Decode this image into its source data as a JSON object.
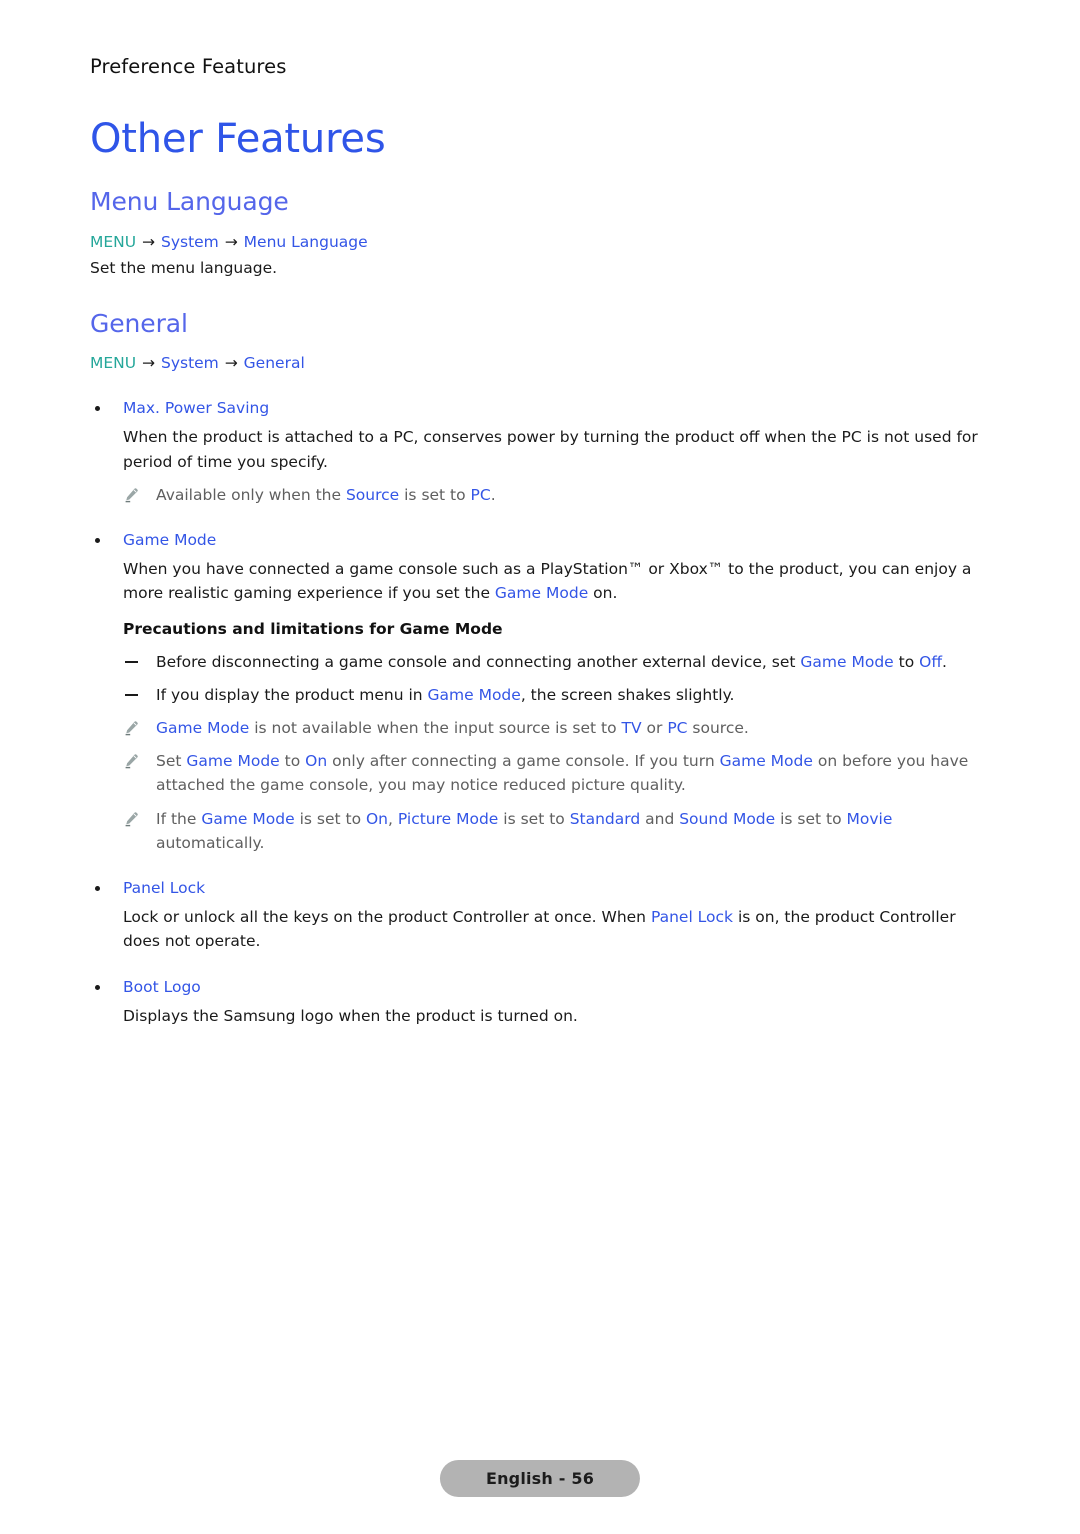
{
  "running_head": "Preference Features",
  "chapter_title": "Other Features",
  "colors": {
    "chapter_blue": "#2f55e8",
    "section_blue": "#5566ea",
    "keyword_blue": "#3355e6",
    "menu_teal": "#25a79a",
    "note_gray": "#5f5f5f",
    "footer_gray": "#b3b3b3"
  },
  "sections": [
    {
      "title": "Menu Language",
      "menu_path": {
        "menu": "MENU",
        "arrow": "→",
        "items": [
          "System",
          "Menu Language"
        ]
      },
      "description": "Set the menu language."
    },
    {
      "title": "General",
      "menu_path": {
        "menu": "MENU",
        "arrow": "→",
        "items": [
          "System",
          "General"
        ]
      }
    }
  ],
  "bullets": [
    {
      "label": "Max. Power Saving",
      "body_part_1": "When the product is attached to a PC, conserves power by turning the product off when the PC is not used for period of time you specify.",
      "notes": [
        {
          "icon": "pencil-icon",
          "runs": [
            {
              "t": "Available only when the ",
              "style": "plain"
            },
            {
              "t": "Source",
              "style": "kw"
            },
            {
              "t": " is set to ",
              "style": "plain"
            },
            {
              "t": "PC",
              "style": "kw"
            },
            {
              "t": ".",
              "style": "plain"
            }
          ]
        }
      ]
    },
    {
      "label": "Game Mode",
      "body_runs": [
        {
          "t": "When you have connected a game console such as a PlayStation™ or Xbox™ to the product, you can enjoy a more realistic gaming experience if you set the ",
          "style": "plain"
        },
        {
          "t": "Game Mode",
          "style": "kw"
        },
        {
          "t": " on.",
          "style": "plain"
        }
      ],
      "sub_head": "Precautions and limitations for Game Mode",
      "dashes": [
        {
          "runs": [
            {
              "t": "Before disconnecting a game console and connecting another external device, set ",
              "style": "plain"
            },
            {
              "t": "Game Mode",
              "style": "kw"
            },
            {
              "t": " to ",
              "style": "plain"
            },
            {
              "t": "Off",
              "style": "kw"
            },
            {
              "t": ".",
              "style": "plain"
            }
          ]
        },
        {
          "runs": [
            {
              "t": "If you display the product menu in ",
              "style": "plain"
            },
            {
              "t": "Game Mode",
              "style": "kw"
            },
            {
              "t": ", the screen shakes slightly.",
              "style": "plain"
            }
          ]
        }
      ],
      "notes": [
        {
          "icon": "pencil-icon",
          "runs": [
            {
              "t": "Game Mode",
              "style": "kw"
            },
            {
              "t": " is not available when the input source is set to ",
              "style": "plain"
            },
            {
              "t": "TV",
              "style": "kw"
            },
            {
              "t": " or ",
              "style": "plain"
            },
            {
              "t": "PC",
              "style": "kw"
            },
            {
              "t": " source.",
              "style": "plain"
            }
          ]
        },
        {
          "icon": "pencil-icon",
          "runs": [
            {
              "t": "Set ",
              "style": "plain"
            },
            {
              "t": "Game Mode",
              "style": "kw"
            },
            {
              "t": " to ",
              "style": "plain"
            },
            {
              "t": "On",
              "style": "kw"
            },
            {
              "t": " only after connecting a game console. If you turn ",
              "style": "plain"
            },
            {
              "t": "Game Mode",
              "style": "kw"
            },
            {
              "t": " on before you have attached the game console, you may notice reduced picture quality.",
              "style": "plain"
            }
          ]
        },
        {
          "icon": "pencil-icon",
          "runs": [
            {
              "t": "If the ",
              "style": "plain"
            },
            {
              "t": "Game Mode",
              "style": "kw"
            },
            {
              "t": " is set to ",
              "style": "plain"
            },
            {
              "t": "On",
              "style": "kw"
            },
            {
              "t": ", ",
              "style": "plain"
            },
            {
              "t": "Picture Mode",
              "style": "kw"
            },
            {
              "t": " is set to ",
              "style": "plain"
            },
            {
              "t": "Standard",
              "style": "kw"
            },
            {
              "t": " and ",
              "style": "plain"
            },
            {
              "t": "Sound Mode",
              "style": "kw"
            },
            {
              "t": " is set to ",
              "style": "plain"
            },
            {
              "t": "Movie",
              "style": "kw"
            },
            {
              "t": " automatically.",
              "style": "plain"
            }
          ]
        }
      ]
    },
    {
      "label": "Panel Lock",
      "body_runs": [
        {
          "t": "Lock or unlock all the keys on the product Controller at once. When ",
          "style": "plain"
        },
        {
          "t": "Panel Lock",
          "style": "kw"
        },
        {
          "t": " is on, the product Controller does not operate.",
          "style": "plain"
        }
      ]
    },
    {
      "label": "Boot Logo",
      "body_runs": [
        {
          "t": "Displays the Samsung logo when the product is turned on.",
          "style": "plain"
        }
      ]
    }
  ],
  "footer": {
    "label": "English - 56"
  }
}
